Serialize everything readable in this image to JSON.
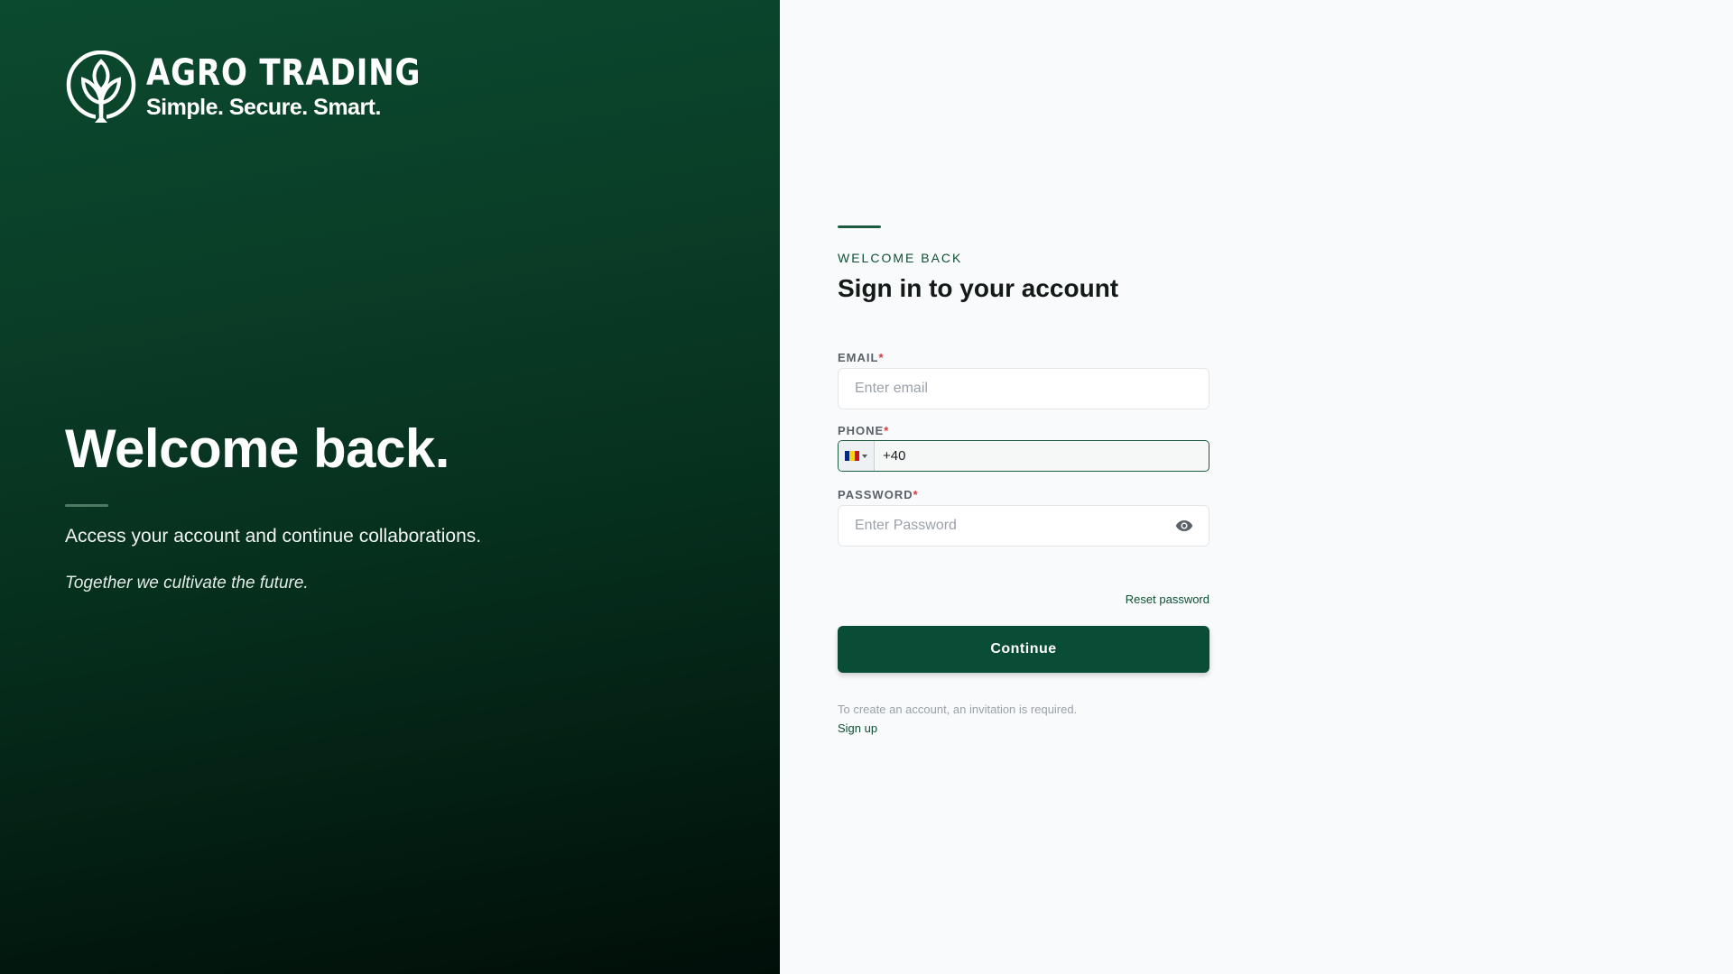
{
  "brand": {
    "name": "AGRO TRADING",
    "tagline": "Simple. Secure. Smart."
  },
  "hero": {
    "title": "Welcome back.",
    "subtitle": "Access your account and continue collaborations.",
    "quote": "Together we cultivate the future."
  },
  "form": {
    "eyebrow": "WELCOME BACK",
    "title": "Sign in to your account",
    "email": {
      "label": "EMAIL",
      "required_mark": "*",
      "placeholder": "Enter email",
      "value": ""
    },
    "phone": {
      "label": "PHONE",
      "required_mark": "*",
      "value": "+40",
      "country_flag_colors": [
        "#002B7F",
        "#FCD116",
        "#CE1126"
      ]
    },
    "password": {
      "label": "PASSWORD",
      "required_mark": "*",
      "placeholder": "Enter Password",
      "value": "",
      "toggle_icon": "eye-icon"
    },
    "reset_link": "Reset password",
    "submit_label": "Continue",
    "invite_note": "To create an account, an invitation is required.",
    "signup_link": "Sign up"
  },
  "colors": {
    "brand_green": "#0a4d36",
    "accent_text": "#0e4f34",
    "required": "#d63a3a",
    "right_bg": "#f8fafb"
  }
}
